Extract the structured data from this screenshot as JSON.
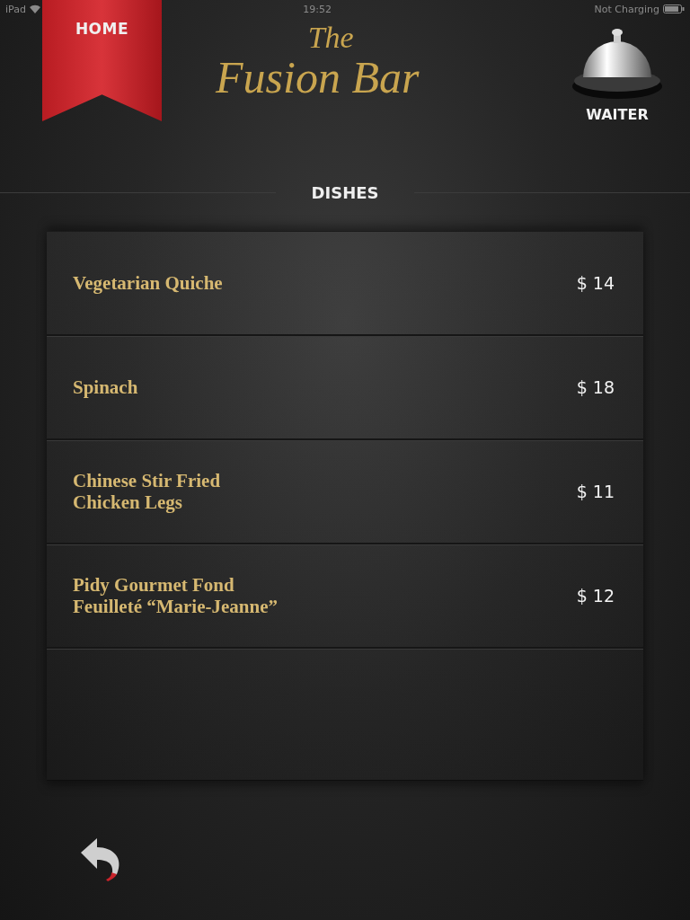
{
  "status_bar": {
    "device": "iPad",
    "time": "19:52",
    "battery_status": "Not Charging"
  },
  "home_button": {
    "label": "HOME"
  },
  "logo": {
    "small": "The",
    "main": "Fusion Bar"
  },
  "waiter_button": {
    "label": "WAITER"
  },
  "section": {
    "title": "DISHES"
  },
  "dishes": [
    {
      "name": "Vegetarian Quiche",
      "price": "$ 14"
    },
    {
      "name": "Spinach",
      "price": "$ 18"
    },
    {
      "name": "Chinese Stir Fried\nChicken Legs",
      "price": "$ 11"
    },
    {
      "name": "Pidy Gourmet Fond\nFeuilleté “Marie-Jeanne”",
      "price": "$ 12"
    }
  ]
}
